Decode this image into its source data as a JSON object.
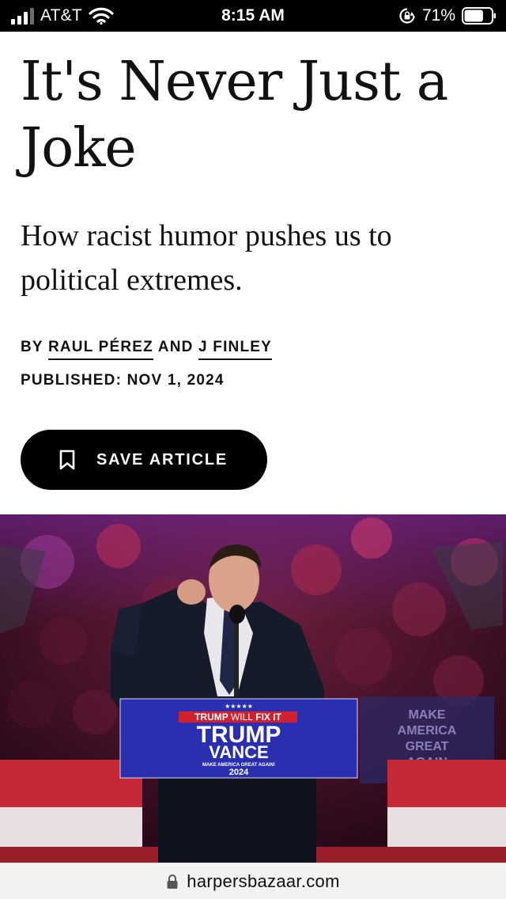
{
  "status_bar": {
    "carrier": "AT&T",
    "time": "8:15 AM",
    "battery_percent": "71%",
    "battery_level": 0.71,
    "signal_bars_active": 3,
    "signal_bars_total": 4,
    "icons": [
      "signal-icon",
      "wifi-icon",
      "rotation-lock-icon",
      "battery-icon"
    ]
  },
  "article": {
    "headline_line1": "It's Never Just a",
    "headline_line2": "Joke",
    "dek_line1": "How racist humor pushes us to",
    "dek_line2": "political extremes.",
    "byline": {
      "prefix": "BY",
      "author1": "RAUL PÉREZ",
      "conjunction": "AND",
      "author2": "J FINLEY"
    },
    "published": "PUBLISHED: NOV 1, 2024",
    "save_button": {
      "label": "SAVE ARTICLE",
      "icon": "bookmark-icon"
    }
  },
  "hero_image": {
    "podium_sign": {
      "stars": "★★★★★",
      "slogan_part1": "TRUMP",
      "slogan_part2": "WILL",
      "slogan_part3": "FIX IT",
      "name1": "TRUMP",
      "name2": "VANCE",
      "tagline": "MAKE AMERICA GREAT AGAIN!",
      "year": "2024"
    },
    "background_sign": {
      "line1": "MAKE",
      "line2": "AMERICA",
      "line3": "GREAT",
      "line4": "AGAIN"
    }
  },
  "browser": {
    "url": "harpersbazaar.com",
    "icon": "lock-icon"
  },
  "colors": {
    "status_bar_bg": "#000000",
    "button_bg": "#000000",
    "podium_blue": "#2a2fb0",
    "podium_red": "#d41f2c",
    "url_bar_bg": "#f2f2f2"
  }
}
